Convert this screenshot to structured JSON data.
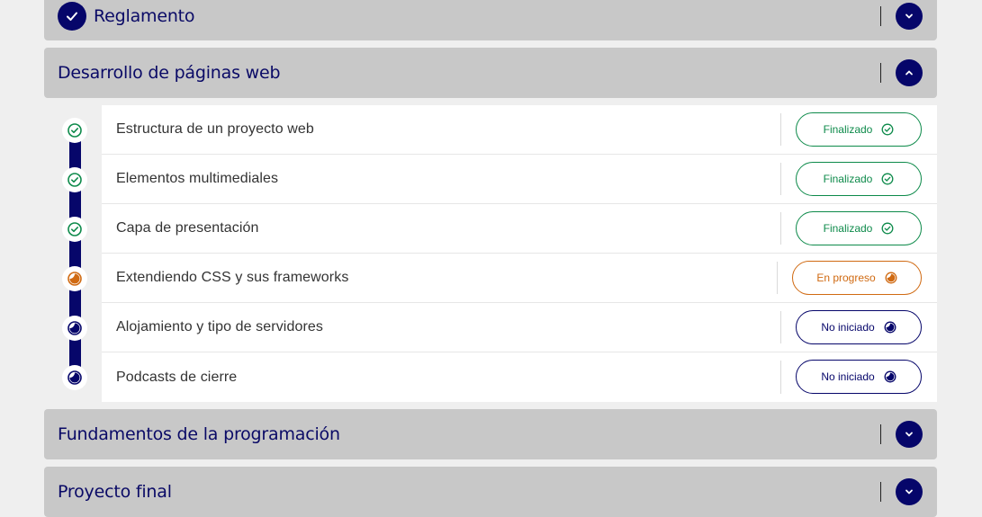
{
  "sections": {
    "reglamento": {
      "title": "Reglamento"
    },
    "desarrollo": {
      "title": "Desarrollo de páginas web"
    },
    "fundamentos": {
      "title": "Fundamentos de la programación"
    },
    "proyecto": {
      "title": "Proyecto final"
    }
  },
  "lessons": [
    {
      "title": "Estructura de un proyecto web",
      "status": "Finalizado",
      "state": "done"
    },
    {
      "title": "Elementos multimediales",
      "status": "Finalizado",
      "state": "done"
    },
    {
      "title": "Capa de presentación",
      "status": "Finalizado",
      "state": "done"
    },
    {
      "title": "Extendiendo CSS y sus frameworks",
      "status": "En progreso",
      "state": "progress"
    },
    {
      "title": "Alojamiento y tipo de servidores",
      "status": "No iniciado",
      "state": "todo"
    },
    {
      "title": "Podcasts de cierre",
      "status": "No iniciado",
      "state": "todo"
    }
  ],
  "colors": {
    "navy": "#06066a",
    "done": "#0d8a4a",
    "progress": "#d06a12",
    "section_bg": "#c8c8c8",
    "page_bg": "#efefef"
  },
  "icons": {
    "section_done": "check-circle-icon",
    "collapse": "chevron-up-icon",
    "expand": "chevron-down-icon",
    "lesson_done": "check-circle-outline-icon",
    "lesson_progress": "half-circle-icon",
    "lesson_todo": "half-circle-icon"
  }
}
